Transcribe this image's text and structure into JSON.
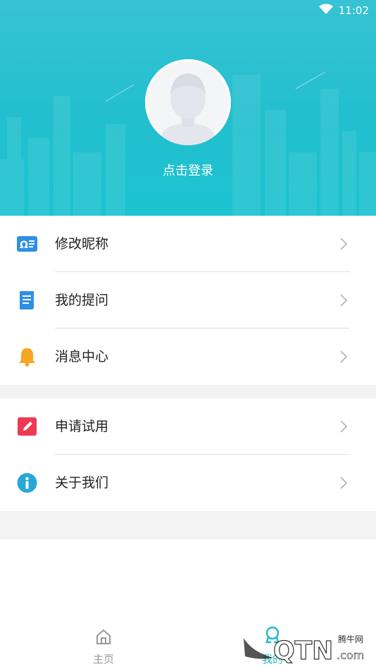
{
  "status_bar": {
    "time": "11:02",
    "wifi_icon": "wifi-icon"
  },
  "profile": {
    "login_text": "点击登录",
    "avatar_icon": "default-avatar-icon"
  },
  "menu_group_1": [
    {
      "label": "修改昵称",
      "icon": "nickname-card-icon"
    },
    {
      "label": "我的提问",
      "icon": "document-icon"
    },
    {
      "label": "消息中心",
      "icon": "bell-icon"
    }
  ],
  "menu_group_2": [
    {
      "label": "申请试用",
      "icon": "edit-pencil-icon"
    },
    {
      "label": "关于我们",
      "icon": "info-icon"
    }
  ],
  "tab_bar": {
    "tabs": [
      {
        "label": "主页",
        "icon": "home-icon",
        "active": false
      },
      {
        "label": "我的",
        "icon": "user-icon",
        "active": true
      }
    ]
  },
  "watermark": {
    "text_top": "腾牛网",
    "text_main": "QTN",
    "text_suffix": ".com"
  },
  "colors": {
    "accent": "#1fb9c8",
    "header_top": "#37c3d3",
    "header_bottom": "#1cc3d0",
    "chevron": "#b8b8b8",
    "tab_inactive": "#9a9a9a"
  }
}
